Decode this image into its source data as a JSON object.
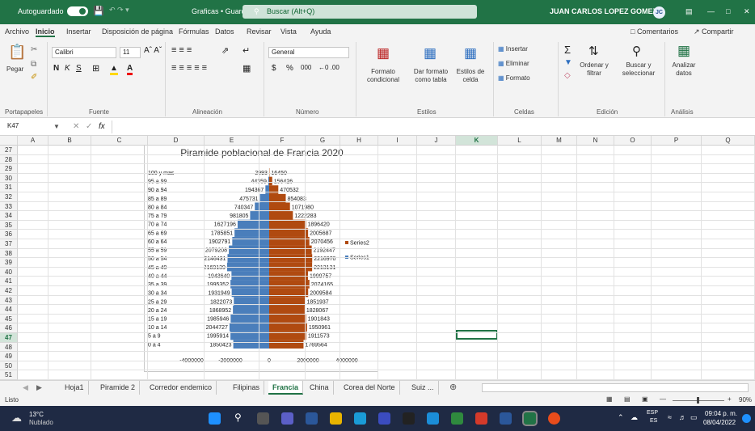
{
  "titlebar": {
    "autosave": "Autoguardado",
    "doc_title": "Graficas • Guardado",
    "search": "Buscar (Alt+Q)",
    "user": "JUAN CARLOS LOPEZ GOMEZ",
    "initials": "JC"
  },
  "menu": [
    "Archivo",
    "Inicio",
    "Insertar",
    "Disposición de página",
    "Fórmulas",
    "Datos",
    "Revisar",
    "Vista",
    "Ayuda"
  ],
  "menu_right": {
    "comments": "Comentarios",
    "share": "Compartir"
  },
  "ribbon": {
    "font_name": "Calibri",
    "font_size": "11",
    "number_format": "General",
    "paste": "Pegar",
    "conditional": "Formato condicional",
    "table": "Dar formato como tabla",
    "styles": "Estilos de celda",
    "insert": "Insertar",
    "delete": "Eliminar",
    "format": "Formato",
    "sort": "Ordenar y filtrar",
    "find": "Buscar y seleccionar",
    "analyze": "Analizar datos",
    "groups": [
      "Portapapeles",
      "Fuente",
      "Alineación",
      "Número",
      "Estilos",
      "Celdas",
      "Edición",
      "Análisis"
    ]
  },
  "formula": {
    "namebox": "K47",
    "fx": "fx"
  },
  "columns": [
    "A",
    "B",
    "C",
    "D",
    "E",
    "F",
    "G",
    "H",
    "I",
    "J",
    "K",
    "L",
    "M",
    "N",
    "O",
    "P",
    "Q"
  ],
  "rows": [
    "27",
    "28",
    "29",
    "30",
    "31",
    "32",
    "33",
    "34",
    "35",
    "36",
    "37",
    "38",
    "39",
    "40",
    "41",
    "42",
    "43",
    "44",
    "45",
    "46",
    "47",
    "48",
    "49",
    "50",
    "51"
  ],
  "chart_data": {
    "type": "bar",
    "title": "Piramide poblacional de Francia 2020",
    "categories": [
      "100 y mas",
      "95 a 99",
      "90 a 94",
      "85 a 89",
      "80 a 84",
      "75 a 79",
      "70 a 74",
      "65 a 69",
      "60 a 64",
      "55 a 59",
      "50 a 54",
      "45 a 49",
      "40 a 44",
      "35 a 39",
      "30 a 34",
      "25 a 29",
      "20 a 24",
      "15 a 19",
      "10 a 14",
      "5 a 9",
      "0 a 4"
    ],
    "series": [
      {
        "name": "Series1",
        "color": "#4a7ebb",
        "values": [
          2993,
          44359,
          194367,
          475731,
          740347,
          981805,
          1627196,
          1785851,
          1902791,
          2079208,
          2146431,
          2169139,
          1943640,
          1995352,
          1931949,
          1822073,
          1868952,
          1985946,
          2044727,
          1995914,
          1850423
        ]
      },
      {
        "name": "Series2",
        "color": "#b04a10",
        "values": [
          16450,
          156426,
          470532,
          854083,
          1071980,
          1222283,
          1896420,
          2005687,
          2070456,
          2192447,
          2216970,
          2213131,
          1999757,
          2074165,
          2009584,
          1851937,
          1828067,
          1901843,
          1950961,
          1911573,
          1769564
        ]
      }
    ],
    "xticks": [
      "-4000000",
      "-2000000",
      "0",
      "2000000",
      "4000000"
    ],
    "xlim": [
      -4000000,
      4000000
    ]
  },
  "sheets": [
    "Hoja1",
    "Piramide 2",
    "Corredor endemico",
    "Filipinas",
    "Francia",
    "China",
    "Corea del Norte",
    "Suiz ..."
  ],
  "active_sheet": "Francia",
  "status": {
    "ready": "Listo",
    "zoom": "90%"
  },
  "taskbar": {
    "temp": "13°C",
    "weather": "Nublado",
    "lang": "ESP",
    "lang2": "ES",
    "time": "09:04 p. m.",
    "date": "08/04/2022"
  }
}
